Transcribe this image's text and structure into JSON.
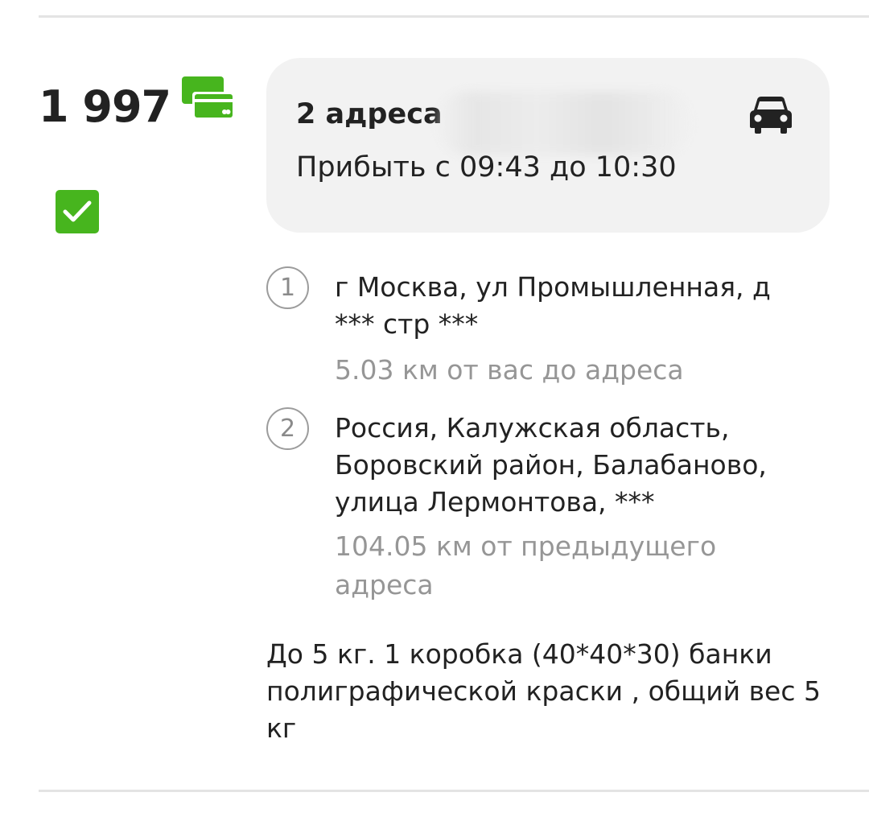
{
  "order": {
    "price": "1 997",
    "payment_icon": "credit-card-icon",
    "selected": true,
    "accent_color": "#47b51e"
  },
  "route": {
    "title": "2 адреса",
    "arrival": "Прибыть с 09:43 до 10:30",
    "vehicle_icon": "car-icon",
    "background_color": "#f2f2f2"
  },
  "stops": [
    {
      "number": "1",
      "address": "г Москва, ул Промышленная, д *** стр ***",
      "distance": "5.03 км от вас до адреса"
    },
    {
      "number": "2",
      "address": "Россия, Калужская область, Боровский район, Балабаново, улица Лермонтова, ***",
      "distance": "104.05 км от предыдущего адреса"
    }
  ],
  "description": "До 5 кг. 1 коробка (40*40*30) банки полиграфической краски , общий вес 5 кг"
}
